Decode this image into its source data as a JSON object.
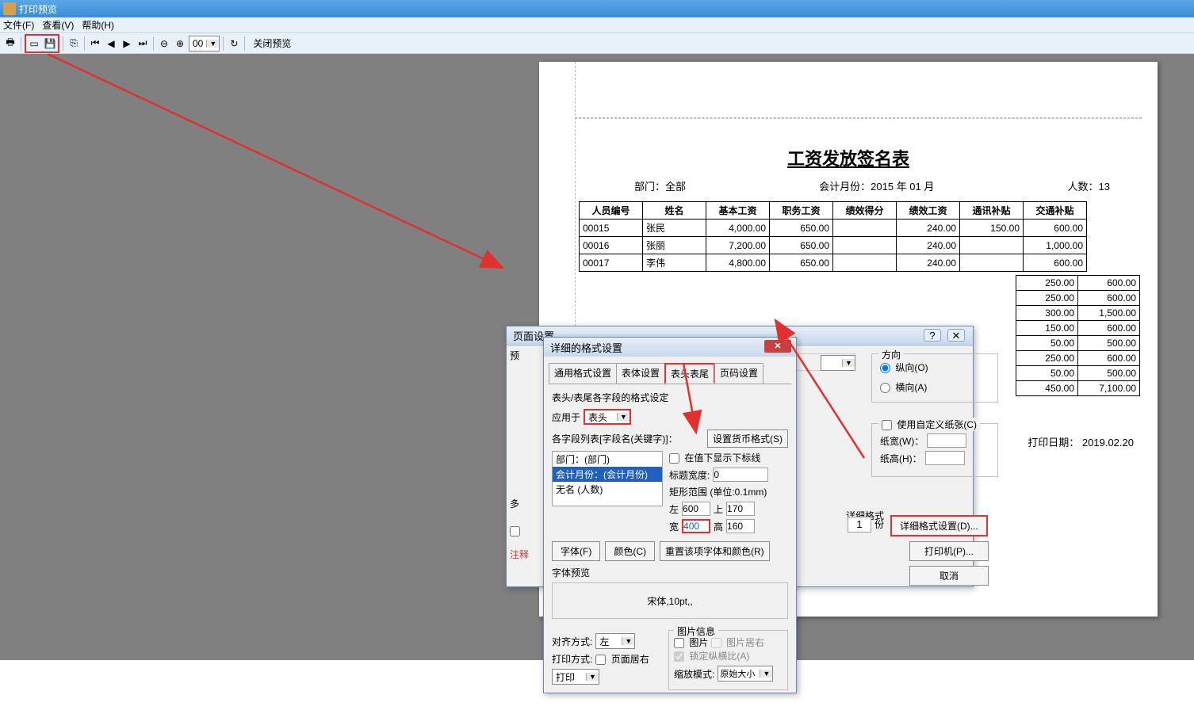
{
  "window": {
    "title": "打印预览"
  },
  "menu": {
    "file": "文件(F)",
    "view": "查看(V)",
    "help": "帮助(H)"
  },
  "toolbar": {
    "close": "关闭预览",
    "zoom_combo": "00"
  },
  "report": {
    "title": "工资发放签名表",
    "dept_label": "部门：",
    "dept_value": "全部",
    "period_label": "会计月份：",
    "period_value": "2015 年 01 月",
    "count_label": "人数：",
    "count_value": "13",
    "print_date_label": "打印日期：",
    "print_date_value": "2019.02.20",
    "columns": [
      "人员编号",
      "姓名",
      "基本工资",
      "职务工资",
      "绩效得分",
      "绩效工资",
      "通讯补贴",
      "交通补贴"
    ],
    "rows": [
      {
        "id": "00015",
        "name": "张民",
        "c1": "4,000.00",
        "c2": "650.00",
        "c3": "",
        "c4": "240.00",
        "c5": "150.00",
        "c6": "600.00"
      },
      {
        "id": "00016",
        "name": "张丽",
        "c1": "7,200.00",
        "c2": "650.00",
        "c3": "",
        "c4": "240.00",
        "c5": "",
        "c6": "1,000.00"
      },
      {
        "id": "00017",
        "name": "李伟",
        "c1": "4,800.00",
        "c2": "650.00",
        "c3": "",
        "c4": "240.00",
        "c5": "",
        "c6": "600.00"
      }
    ],
    "partial_rows": [
      {
        "c5": "250.00",
        "c6": "600.00"
      },
      {
        "c5": "250.00",
        "c6": "600.00"
      },
      {
        "c5": "300.00",
        "c6": "1,500.00"
      },
      {
        "c5": "150.00",
        "c6": "600.00"
      },
      {
        "c5": "50.00",
        "c6": "500.00"
      },
      {
        "c5": "250.00",
        "c6": "600.00"
      },
      {
        "c5": "50.00",
        "c6": "500.00"
      },
      {
        "c5": "450.00",
        "c6": "7,100.00"
      }
    ]
  },
  "dlg1": {
    "title": "页面设置",
    "preview_label": "预",
    "multi_label": "多",
    "note": "注释",
    "direction": {
      "legend": "方向",
      "portrait": "纵向(O)",
      "landscape": "横向(A)"
    },
    "paper": {
      "legend": "使用自定义纸张(C)",
      "width": "纸宽(W)：",
      "height": "纸高(H)："
    },
    "detail_legend": "详细格式",
    "detail_btn": "详细格式设置(D)...",
    "printer_btn": "打印机(P)...",
    "cancel_btn": "取消",
    "copies_label": "份",
    "copies_value": "1"
  },
  "dlg2": {
    "title": "详细的格式设置",
    "tabs": {
      "t1": "通用格式设置",
      "t2": "表体设置",
      "t3": "表头表尾",
      "t4": "页码设置"
    },
    "section": "表头/表尾各字段的格式设定",
    "apply_to_label": "应用于",
    "apply_to_value": "表头",
    "fields_label": "各字段列表[字段名(关键字)]：",
    "currency_btn": "设置货币格式(S)",
    "list": {
      "i1": "部门：(部门)",
      "i2": "会计月份：(会计月份)",
      "i3": "无名 (人数)"
    },
    "underline": "在值下显示下标线",
    "title_width_label": "标题宽度:",
    "title_width_value": "0",
    "rect_label": "矩形范围 (单位:0.1mm)",
    "left_label": "左",
    "left_value": "600",
    "top_label": "上",
    "top_value": "170",
    "width_label": "宽",
    "width_value": "400",
    "height_label": "高",
    "height_value": "160",
    "font_btn": "字体(F)",
    "color_btn": "颜色(C)",
    "reset_btn": "重置该项字体和颜色(R)",
    "font_preview_label": "字体预览",
    "font_preview_value": "宋体,10pt,,",
    "align_label": "对齐方式:",
    "align_value": "左",
    "print_mode_label": "打印方式:",
    "page_center": "页面居右",
    "print_value": "打印",
    "image_legend": "图片信息",
    "img_cb": "图片",
    "img_right": "图片居右",
    "lock_ratio": "锁定纵横比(A)",
    "zoom_label": "缩放模式:",
    "zoom_value": "原始大小"
  }
}
